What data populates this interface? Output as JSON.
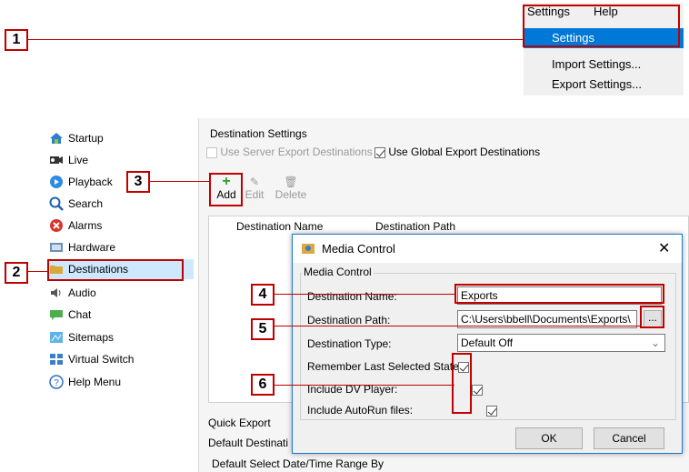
{
  "callouts": [
    "1",
    "2",
    "3",
    "4",
    "5",
    "6"
  ],
  "menu": {
    "bar": [
      "Settings",
      "Help"
    ],
    "items": [
      "Settings",
      "Import Settings...",
      "Export Settings..."
    ],
    "highlight_color": "#0078d7"
  },
  "sidebar": {
    "items": [
      {
        "label": "Startup",
        "icon": "house-icon"
      },
      {
        "label": "Live",
        "icon": "camera-icon"
      },
      {
        "label": "Playback",
        "icon": "playback-icon"
      },
      {
        "label": "Search",
        "icon": "search-icon"
      },
      {
        "label": "Alarms",
        "icon": "alarm-icon"
      },
      {
        "label": "Hardware",
        "icon": "hardware-icon"
      },
      {
        "label": "Destinations",
        "icon": "folder-icon"
      },
      {
        "label": "Audio",
        "icon": "speaker-icon"
      },
      {
        "label": "Chat",
        "icon": "chat-icon"
      },
      {
        "label": "Sitemaps",
        "icon": "sitemap-icon"
      },
      {
        "label": "Virtual Switch",
        "icon": "virtual-switch-icon"
      },
      {
        "label": "Help Menu",
        "icon": "help-icon"
      }
    ]
  },
  "destination_settings": {
    "title": "Destination Settings",
    "use_server": "Use Server Export Destinations",
    "use_global": "Use Global Export Destinations",
    "toolbar": {
      "add": "Add",
      "edit": "Edit",
      "delete": "Delete"
    },
    "columns": [
      "Destination Name",
      "Destination Path"
    ]
  },
  "quick_export": {
    "title": "Quick Export",
    "default_destination": "Default Destinati",
    "default_select": "Default Select Date/Time Range By"
  },
  "dialog": {
    "title": "Media Control",
    "group": "Media Control",
    "labels": {
      "name": "Destination Name:",
      "path": "Destination Path:",
      "type": "Destination Type:",
      "remember": "Remember Last Selected State:",
      "dv_player": "Include DV Player:",
      "autorun": "Include AutoRun files:"
    },
    "values": {
      "name": "Exports",
      "path": "C:\\Users\\bbell\\Documents\\Exports\\",
      "type": "Default Off",
      "browse": "..."
    },
    "ok": "OK",
    "cancel": "Cancel"
  }
}
